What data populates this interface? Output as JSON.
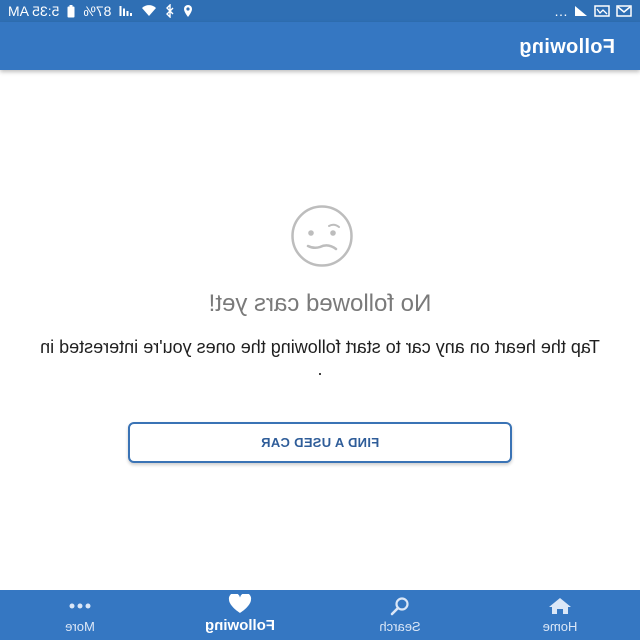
{
  "status_bar": {
    "time": "5:35 AM",
    "battery": "87%",
    "overflow": "…",
    "icons": [
      "notification-icon",
      "notification-icon",
      "notification-icon",
      "location-icon",
      "bluetooth-icon",
      "wifi-icon",
      "signal-icon",
      "battery-icon"
    ]
  },
  "header": {
    "title": "Following"
  },
  "empty_state": {
    "icon": "confused-face-icon",
    "title": "No followed cars yet!",
    "message": "Tap the heart on any car to start following the ones you're interested in .",
    "button_label": "FIND A USED CAR"
  },
  "bottom_nav": {
    "items": [
      {
        "label": "Home",
        "icon": "home-icon",
        "active": false
      },
      {
        "label": "Search",
        "icon": "search-icon",
        "active": false
      },
      {
        "label": "Following",
        "icon": "heart-icon",
        "active": true
      },
      {
        "label": "More",
        "icon": "more-icon",
        "active": false
      }
    ]
  },
  "colors": {
    "primary": "#3577c2",
    "status_bar": "#2f6fb4",
    "button_border": "#3a73b5",
    "empty_title": "#7a7a7a"
  }
}
